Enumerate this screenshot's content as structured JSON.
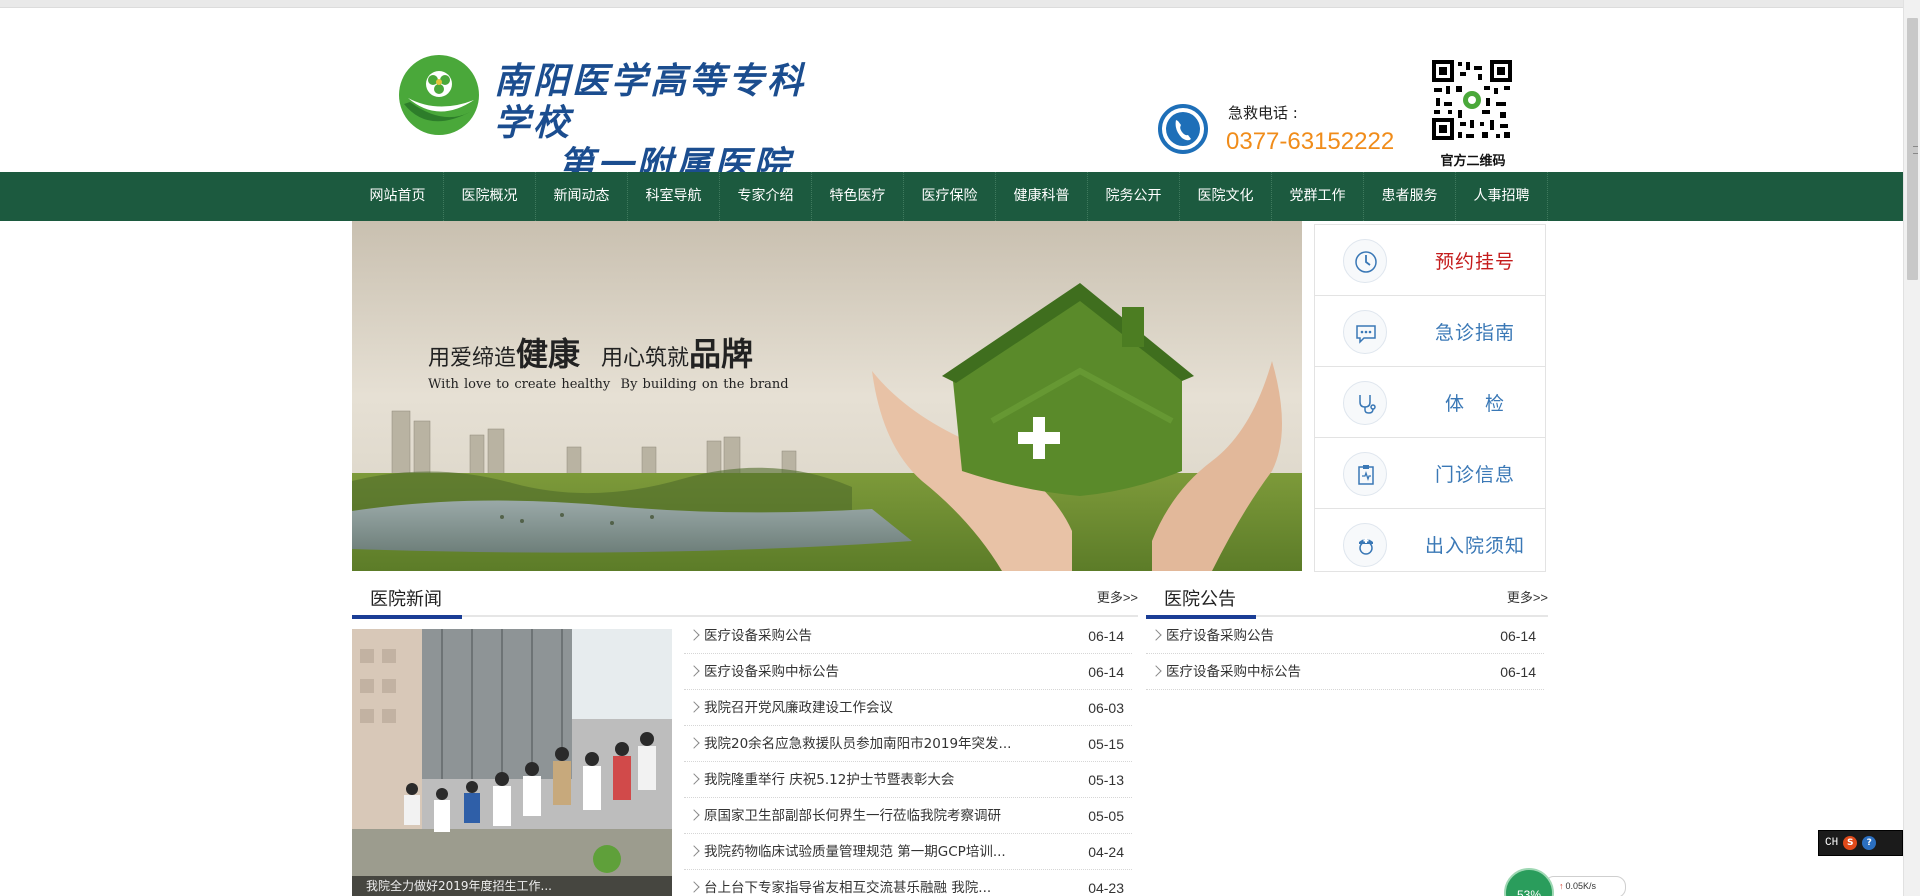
{
  "header": {
    "logo_line1": "南阳医学高等专科学校",
    "logo_line2": "第一附属医院",
    "hotline_label": "急救电话 :",
    "hotline_number": "0377-63152222",
    "qr_label": "官方二维码"
  },
  "nav": {
    "items": [
      "网站首页",
      "医院概况",
      "新闻动态",
      "科室导航",
      "专家介绍",
      "特色医疗",
      "医疗保险",
      "健康科普",
      "院务公开",
      "医院文化",
      "党群工作",
      "患者服务",
      "人事招聘"
    ]
  },
  "banner": {
    "slogan_cn_a1": "用爱缔造",
    "slogan_cn_a2": "健康",
    "slogan_cn_b1": "用心筑就",
    "slogan_cn_b2": "品牌",
    "slogan_en_a": "With love to create healthy",
    "slogan_en_b": "By building on the brand"
  },
  "quick_links": [
    {
      "label": "预约挂号",
      "icon": "clock-icon"
    },
    {
      "label": "急诊指南",
      "icon": "chat-bubble-icon"
    },
    {
      "label": "体　检",
      "icon": "stethoscope-icon"
    },
    {
      "label": "门诊信息",
      "icon": "clipboard-icon"
    },
    {
      "label": "出入院须知",
      "icon": "nurse-icon"
    }
  ],
  "news": {
    "title": "医院新闻",
    "more": "更多>>",
    "photo_caption": "我院全力做好2019年度招生工作...",
    "items": [
      {
        "title": "医疗设备采购公告",
        "date": "06-14"
      },
      {
        "title": "医疗设备采购中标公告",
        "date": "06-14"
      },
      {
        "title": "我院召开党风廉政建设工作会议",
        "date": "06-03"
      },
      {
        "title": "我院20余名应急救援队员参加南阳市2019年突发...",
        "date": "05-15"
      },
      {
        "title": "我院隆重举行 庆祝5.12护士节暨表彰大会",
        "date": "05-13"
      },
      {
        "title": "原国家卫生部副部长何界生一行莅临我院考察调研",
        "date": "05-05"
      },
      {
        "title": "我院药物临床试验质量管理规范 第一期GCP培训...",
        "date": "04-24"
      },
      {
        "title": "台上台下专家指导省友相互交流甚乐融融 我院...",
        "date": "04-23"
      }
    ]
  },
  "notices": {
    "title": "医院公告",
    "more": "更多>>",
    "items": [
      {
        "title": "医疗设备采购公告",
        "date": "06-14"
      },
      {
        "title": "医疗设备采购中标公告",
        "date": "06-14"
      }
    ]
  },
  "system": {
    "ime_label": "CH",
    "ime_s": "S",
    "ime_help": "?",
    "speed_percent": "53%",
    "speed_rate": "0.05K/s"
  },
  "colors": {
    "nav_bg": "#1c5a3f",
    "accent_blue": "#1a3d95",
    "hotline_orange": "#f08c1a",
    "quick_red": "#c41b1b",
    "quick_blue": "#3a78b6"
  }
}
